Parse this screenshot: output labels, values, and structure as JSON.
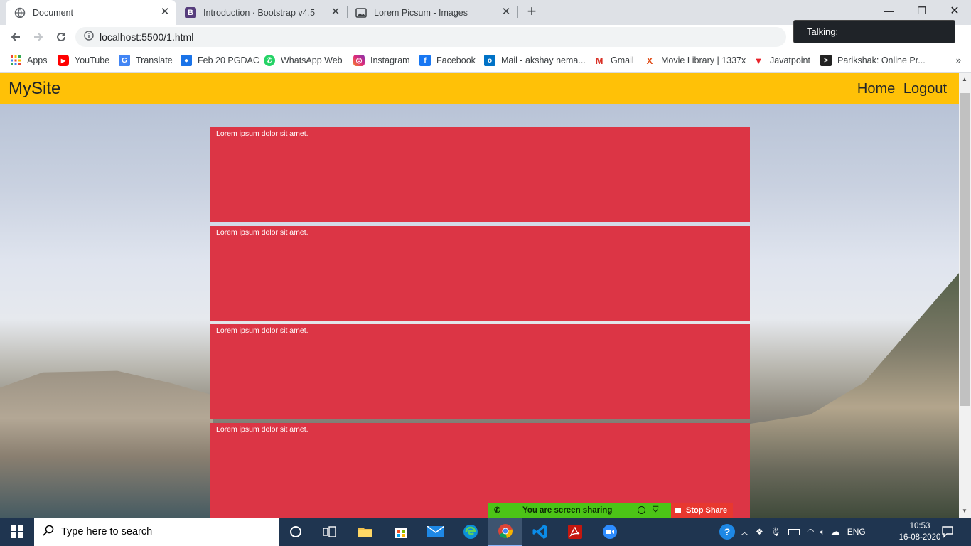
{
  "browser": {
    "tabs": [
      {
        "title": "Document",
        "icon": "globe-icon"
      },
      {
        "title": "Introduction · Bootstrap v4.5",
        "icon": "bootstrap-icon"
      },
      {
        "title": "Lorem Picsum - Images",
        "icon": "image-icon"
      }
    ],
    "new_tab": "+",
    "url": "localhost:5500/1.html",
    "bookmarks": [
      {
        "label": "Apps",
        "icon": "apps-grid-icon"
      },
      {
        "label": "YouTube",
        "icon": "youtube-icon",
        "color": "#ff0000"
      },
      {
        "label": "Translate",
        "icon": "translate-icon",
        "color": "#4285f4"
      },
      {
        "label": "Feb 20 PGDAC",
        "icon": "classroom-icon",
        "color": "#1a73e8"
      },
      {
        "label": "WhatsApp Web",
        "icon": "whatsapp-icon",
        "color": "#25d366"
      },
      {
        "label": "Instagram",
        "icon": "instagram-icon",
        "color": "#c13584"
      },
      {
        "label": "Facebook",
        "icon": "facebook-icon",
        "color": "#1877f2"
      },
      {
        "label": "Mail - akshay nema...",
        "icon": "outlook-icon",
        "color": "#0072c6"
      },
      {
        "label": "Gmail",
        "icon": "gmail-icon",
        "color": "#d93025"
      },
      {
        "label": "Movie Library | 1337x",
        "icon": "1337x-icon",
        "color": "#e04e1a"
      },
      {
        "label": "Javatpoint",
        "icon": "javatpoint-icon",
        "color": "#e8222a"
      },
      {
        "label": "Parikshak: Online Pr...",
        "icon": "terminal-icon",
        "color": "#222222"
      }
    ],
    "bookmarks_more": "»"
  },
  "page": {
    "brand": "MySite",
    "nav": [
      "Home",
      "Logout"
    ],
    "cards": [
      "Lorem ipsum dolor sit amet.",
      "Lorem ipsum dolor sit amet.",
      "Lorem ipsum dolor sit amet.",
      "Lorem ipsum dolor sit amet."
    ],
    "colors": {
      "navbar": "#ffc107",
      "card": "#dc3545"
    }
  },
  "zoom": {
    "talking": "Talking:",
    "sharing": "You are screen sharing",
    "stop_share": "Stop Share"
  },
  "taskbar": {
    "search_placeholder": "Type here to search",
    "language": "ENG",
    "time": "10:53",
    "date": "16-08-2020"
  }
}
